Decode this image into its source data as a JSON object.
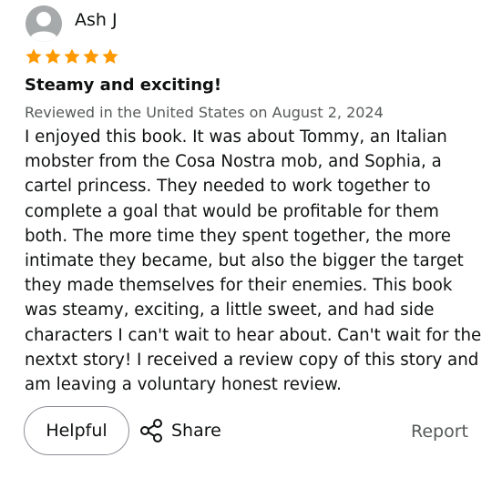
{
  "reviewer": {
    "name": "Ash J",
    "avatar_icon": "default-user-avatar"
  },
  "rating": {
    "stars": 5,
    "max": 5,
    "color": "#ff9900"
  },
  "review": {
    "title": "Steamy and exciting!",
    "meta": "Reviewed in the United States on August 2, 2024",
    "body_lines": [
      "I enjoyed this book. It was about Tommy, an Italian",
      "mobster from the Cosa Nostra mob, and Sophia, a",
      "cartel princess. They needed to work together to",
      "complete a goal that would be profitable for them",
      "both. The more time they spent together, the more",
      "intimate they became, but also the bigger the target",
      "they made themselves for their enemies. This book",
      "was steamy, exciting, a little sweet, and had side",
      "characters I can't wait to hear about. Can't wait for the",
      "nextxt story! I received a review copy of this story and",
      "am leaving a voluntary honest review."
    ]
  },
  "actions": {
    "helpful_label": "Helpful",
    "share_label": "Share",
    "share_icon": "share-icon",
    "report_label": "Report"
  }
}
